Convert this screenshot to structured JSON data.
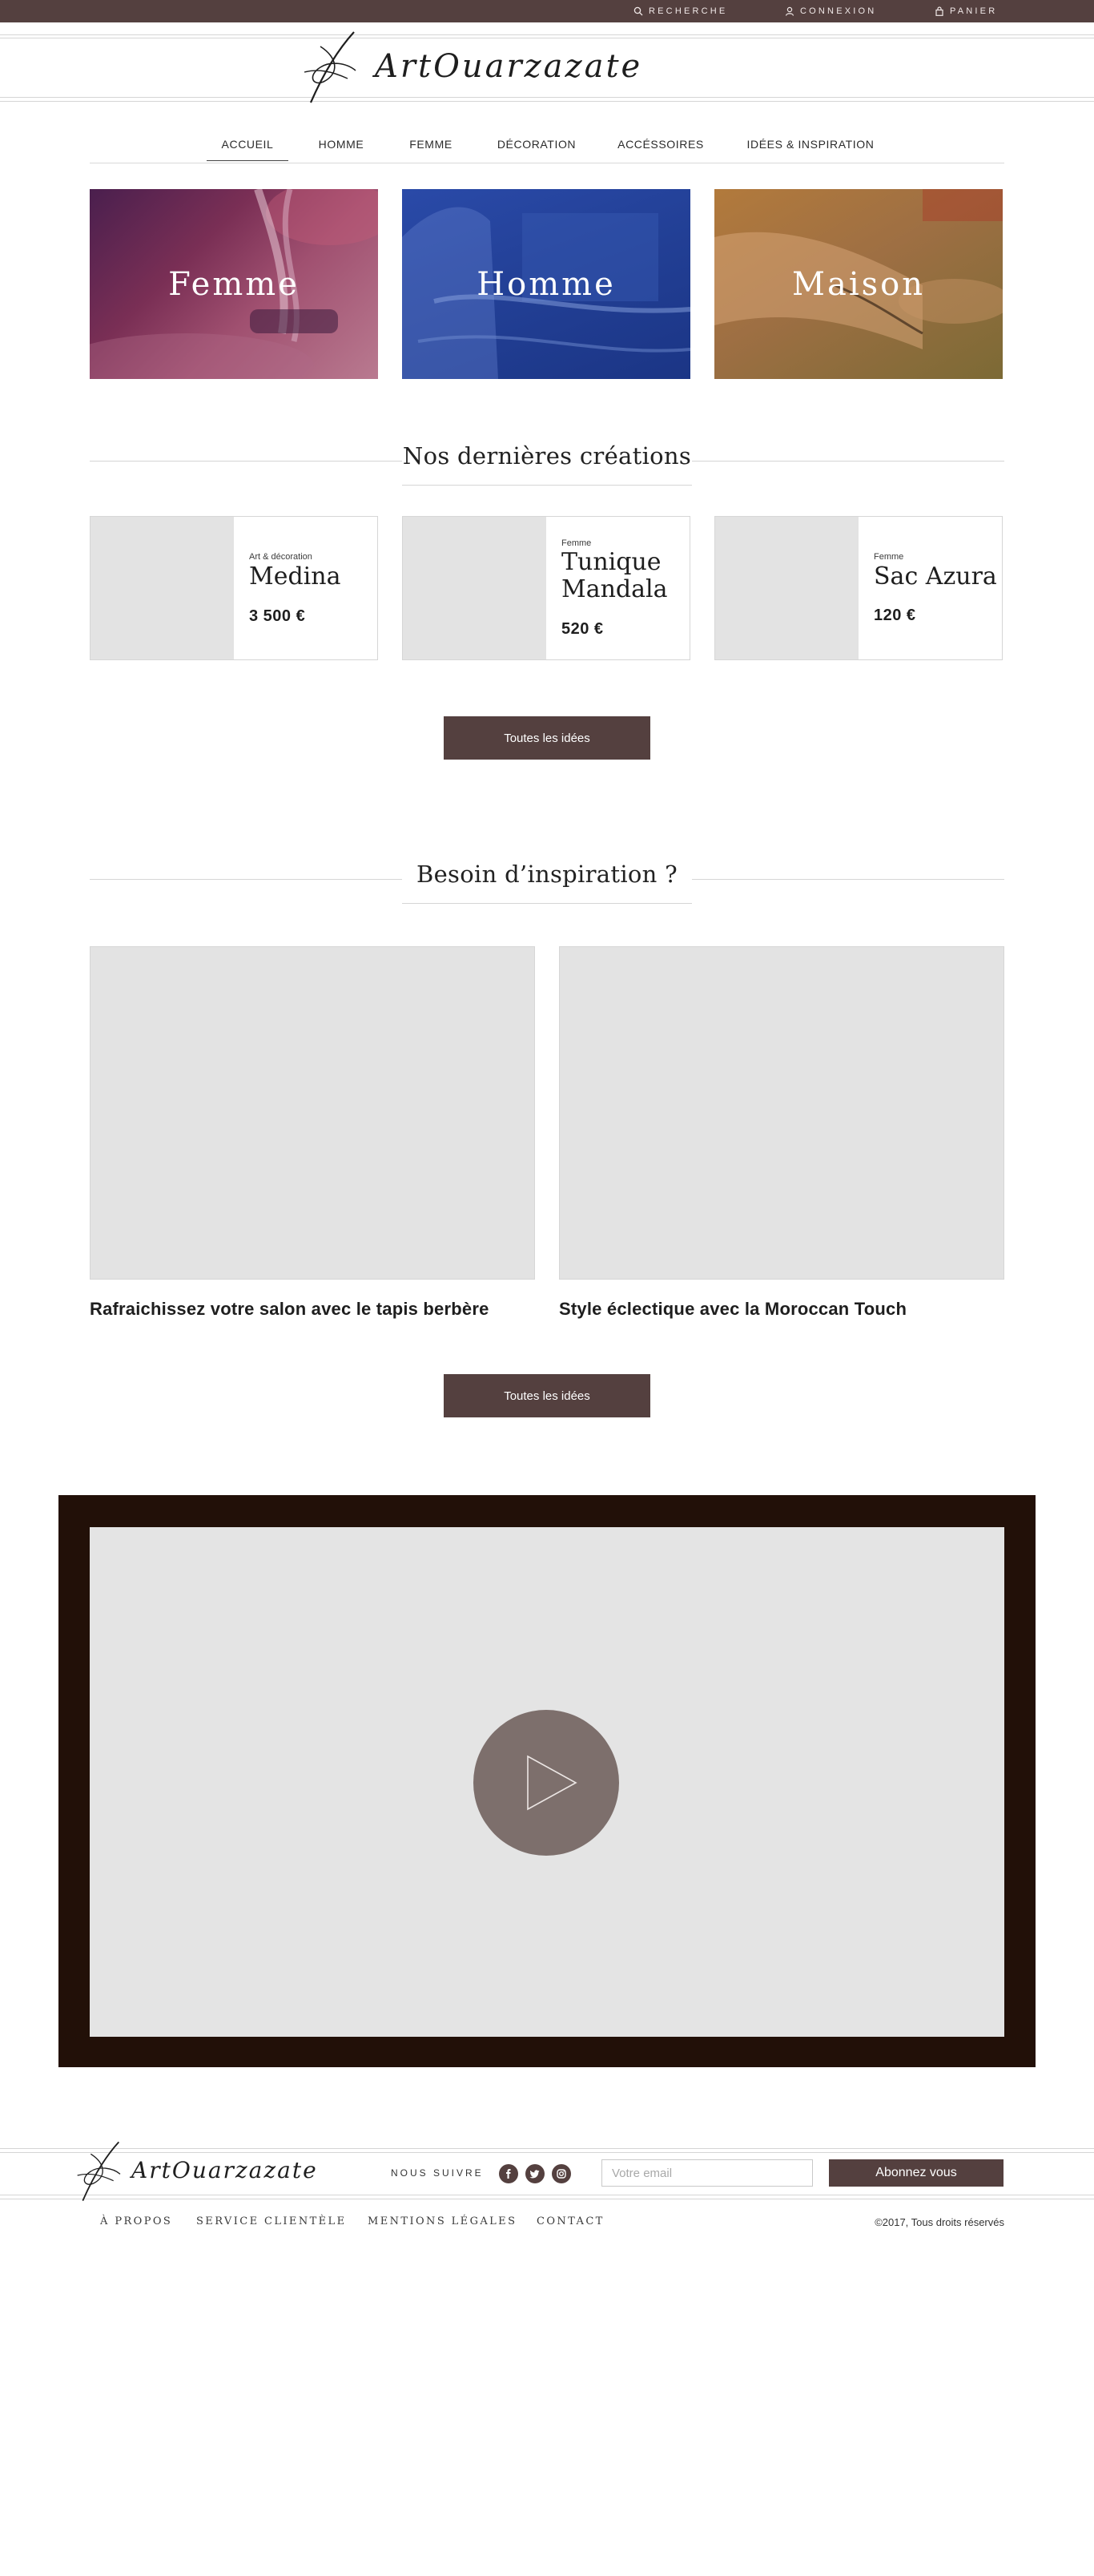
{
  "colors": {
    "accent": "#54403f",
    "video_frame": "#221008",
    "placeholder_gray": "#e3e3e3",
    "play_button": "#7d6f6c"
  },
  "topbar": {
    "search": "Recherche",
    "login": "Connexion",
    "cart": "Panier"
  },
  "header": {
    "logo_text": "ArtOuarzazate"
  },
  "nav": {
    "items": [
      "Accueil",
      "Homme",
      "Femme",
      "Décoration",
      "Accéssoires",
      "Idées & Inspiration"
    ],
    "active": "Accueil"
  },
  "categories": [
    {
      "label": "Femme",
      "tint": "#6a2f6e"
    },
    {
      "label": "Homme",
      "tint": "#24459c"
    },
    {
      "label": "Maison",
      "tint": "#8a6a3a"
    }
  ],
  "latest": {
    "title": "Nos dernières créations",
    "products": [
      {
        "category": "Art & décoration",
        "name": "Medina",
        "price": "3 500 €"
      },
      {
        "category": "Femme",
        "name": "Tunique Mandala",
        "price": "520 €"
      },
      {
        "category": "Femme",
        "name": "Sac Azura",
        "price": "120 €"
      }
    ],
    "button": "Toutes les idées"
  },
  "inspiration": {
    "title": "Besoin d’inspiration ?",
    "articles": [
      {
        "title": "Rafraichissez votre salon avec le tapis berbère"
      },
      {
        "title": "Style éclectique avec la Moroccan Touch"
      }
    ],
    "button": "Toutes les idées"
  },
  "footer": {
    "logo_text": "ArtOuarzazate",
    "follow": "Nous suivre",
    "social_icons": [
      "facebook-icon",
      "twitter-icon",
      "instagram-icon"
    ],
    "email_placeholder": "Votre email",
    "subscribe": "Abonnez vous",
    "links": [
      "À propos",
      "Service clientèle",
      "Mentions légales",
      "Contact"
    ],
    "copyright": "©2017, Tous droits réservés"
  }
}
